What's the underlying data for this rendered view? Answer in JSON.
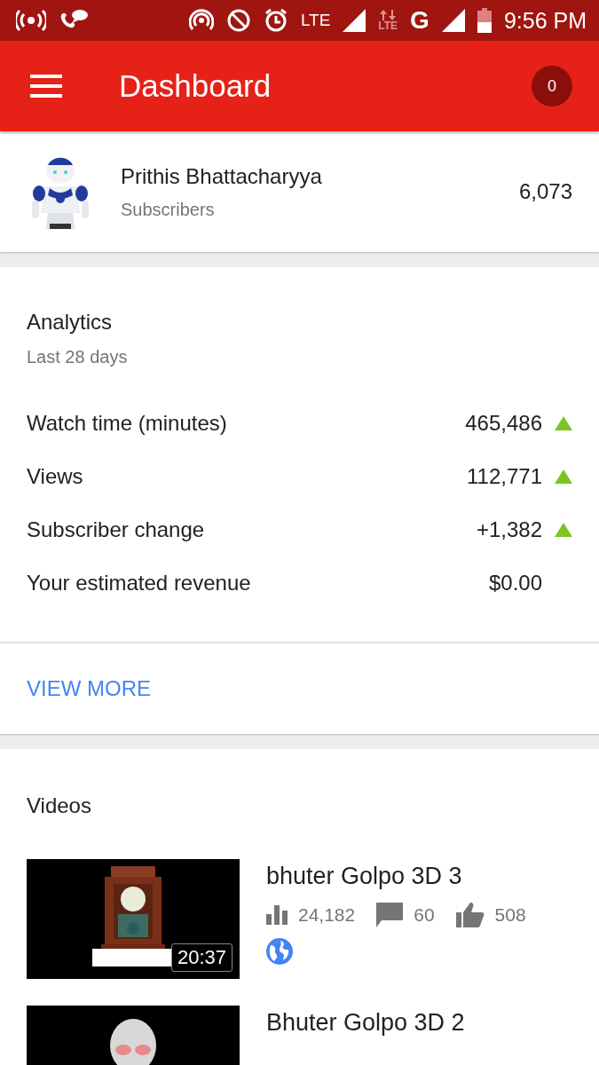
{
  "status_bar": {
    "network_label": "LTE",
    "data_label": "LTE",
    "data_type": "G",
    "time": "9:56 PM"
  },
  "app_bar": {
    "title": "Dashboard",
    "notification_count": "0"
  },
  "channel": {
    "name": "Prithis Bhattacharyya",
    "subscribers_label": "Subscribers",
    "subscribers": "6,073"
  },
  "analytics": {
    "title": "Analytics",
    "period": "Last 28 days",
    "metrics": [
      {
        "label": "Watch time (minutes)",
        "value": "465,486",
        "rising": true
      },
      {
        "label": "Views",
        "value": "112,771",
        "rising": true
      },
      {
        "label": "Subscriber change",
        "value": "+1,382",
        "rising": true
      },
      {
        "label": "Your estimated revenue",
        "value": "$0.00",
        "rising": false
      }
    ],
    "link": "VIEW MORE"
  },
  "videos": {
    "title": "Videos",
    "items": [
      {
        "title": "bhuter Golpo 3D 3",
        "views": "24,182",
        "comments": "60",
        "likes": "508",
        "duration": "20:37",
        "public": true
      },
      {
        "title": "Bhuter Golpo 3D 2"
      }
    ]
  }
}
